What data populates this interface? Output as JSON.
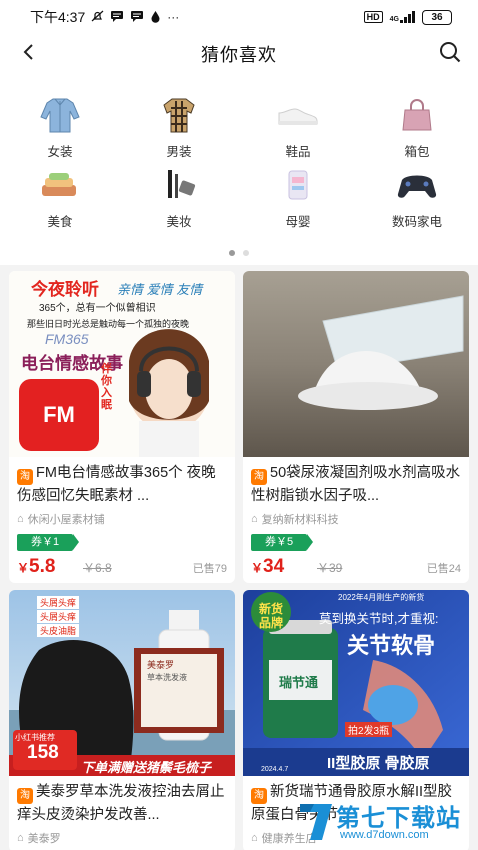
{
  "status": {
    "time": "下午4:37",
    "net": "HD",
    "gen": "4G",
    "battery": "36"
  },
  "header": {
    "title": "猜你喜欢"
  },
  "categories": [
    {
      "label": "女装",
      "icon": "jacket-icon"
    },
    {
      "label": "男装",
      "icon": "shirt-icon"
    },
    {
      "label": "鞋品",
      "icon": "shoe-icon"
    },
    {
      "label": "箱包",
      "icon": "handbag-icon"
    },
    {
      "label": "美食",
      "icon": "food-icon"
    },
    {
      "label": "美妆",
      "icon": "makeup-icon"
    },
    {
      "label": "母婴",
      "icon": "baby-icon"
    },
    {
      "label": "数码家电",
      "icon": "digital-icon"
    }
  ],
  "products": [
    {
      "title": "FM电台情感故事365个 夜晚伤感回忆失眠素材 ...",
      "shop": "休闲小屋素材铺",
      "coupon": "券￥1",
      "currency": "￥",
      "price": "5.8",
      "orig": "￥6.8",
      "sold": "已售79",
      "img": {
        "line1": "今夜聆听",
        "line1b": "亲情 爱情 友情",
        "line2": "365个，总有一个似曾相识",
        "line3": "那些旧日时光总是触动每一个孤独的夜晚",
        "fm365": "FM365",
        "line4": "电台情感故事",
        "fm": "FM",
        "side": "伴你入眠"
      }
    },
    {
      "title": "50袋尿液凝固剂吸水剂高吸水性树脂锁水因子吸...",
      "shop": "复纳新材料科技",
      "coupon": "券￥5",
      "currency": "￥",
      "price": "34",
      "orig": "￥39",
      "sold": "已售24"
    },
    {
      "title": "美泰罗草本洗发液控油去屑止痒头皮烫染护发改善...",
      "shop": "美泰罗",
      "img": {
        "tag1": "头屑头痒",
        "tag2": "头屑头痒",
        "tag3": "头皮油脂",
        "redbook": "小红书推荐",
        "price": "158",
        "promo": "下单满赠送猪鬃毛梳子",
        "box": "美泰罗",
        "box2": "草本洗发液"
      }
    },
    {
      "title": "新货瑞节通骨胶原水解II型胶原蛋白骨关节...",
      "shop": "健康养生店",
      "img": {
        "top": "2022年4月刚生产的新货",
        "badge1": "新货",
        "badge2": "品牌",
        "head": "莫到换关节时,才重视:",
        "big": "关节软骨",
        "brand": "瑞节通",
        "deal": "拍2发3瓶",
        "bottom": "II型胶原 骨胶原",
        "date": "2024.4.7"
      }
    }
  ],
  "watermark": {
    "text": "第七下载站",
    "url": "www.d7down.com"
  },
  "colors": {
    "price": "#e0211a",
    "coupon": "#1aa05a",
    "taobao": "#ff7a00"
  }
}
